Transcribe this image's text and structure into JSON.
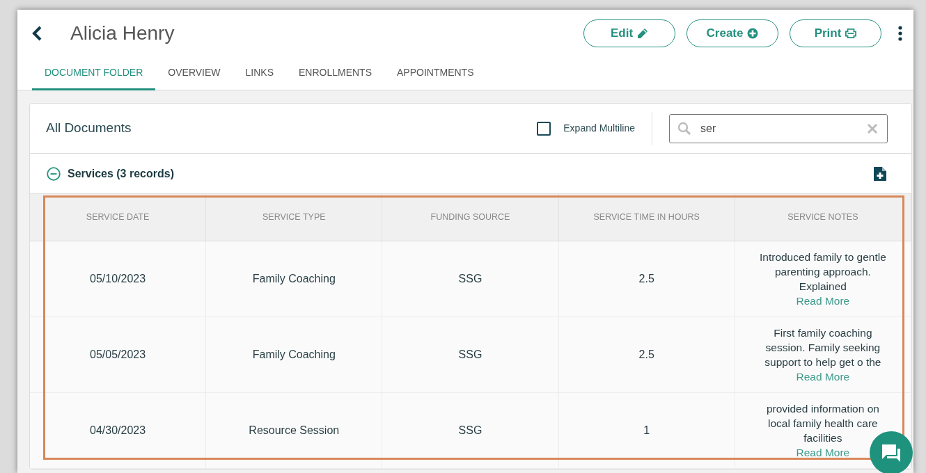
{
  "header": {
    "title": "Alicia Henry",
    "actions": [
      {
        "label": "Edit"
      },
      {
        "label": "Create"
      },
      {
        "label": "Print"
      }
    ]
  },
  "tabs": [
    {
      "label": "DOCUMENT FOLDER",
      "selected": true
    },
    {
      "label": "OVERVIEW",
      "selected": false
    },
    {
      "label": "LINKS",
      "selected": false
    },
    {
      "label": "ENROLLMENTS",
      "selected": false
    },
    {
      "label": "APPOINTMENTS",
      "selected": false
    }
  ],
  "documents": {
    "title": "All Documents",
    "expand_multiline": {
      "label": "Expand Multiline",
      "checked": false
    },
    "search": {
      "value": "ser"
    }
  },
  "section": {
    "title": "Services (3 records)",
    "expanded": true
  },
  "table": {
    "highlighted": true,
    "columns": [
      "SERVICE DATE",
      "SERVICE TYPE",
      "FUNDING SOURCE",
      "SERVICE TIME IN HOURS",
      "SERVICE NOTES"
    ],
    "rows": [
      {
        "cells": [
          "05/10/2023",
          "Family Coaching",
          "SSG",
          "2.5"
        ],
        "note": "Introduced family to gentle parenting approach. Explained",
        "link": "Read More"
      },
      {
        "cells": [
          "05/05/2023",
          "Family Coaching",
          "SSG",
          "2.5"
        ],
        "note": "First family coaching session. Family seeking support to help get o the",
        "link": "Read More"
      },
      {
        "cells": [
          "04/30/2023",
          "Resource Session",
          "SSG",
          "1"
        ],
        "note": "provided information on local family health care facilities",
        "link": "Read More"
      }
    ]
  }
}
